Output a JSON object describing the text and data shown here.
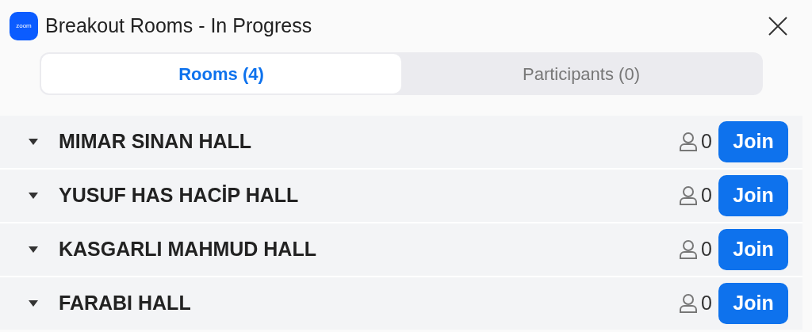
{
  "window": {
    "title": "Breakout Rooms - In Progress",
    "logo": "zoom"
  },
  "tabs": [
    {
      "label": "Rooms (4)",
      "selected": true
    },
    {
      "label": "Participants (0)",
      "selected": false
    }
  ],
  "rooms": [
    {
      "name": "MIMAR SINAN HALL",
      "count": "0",
      "button": "Join"
    },
    {
      "name": "YUSUF HAS HACİP HALL",
      "count": "0",
      "button": "Join"
    },
    {
      "name": "KASGARLI MAHMUD HALL",
      "count": "0",
      "button": "Join"
    },
    {
      "name": "FARABI HALL",
      "count": "0",
      "button": "Join"
    }
  ]
}
